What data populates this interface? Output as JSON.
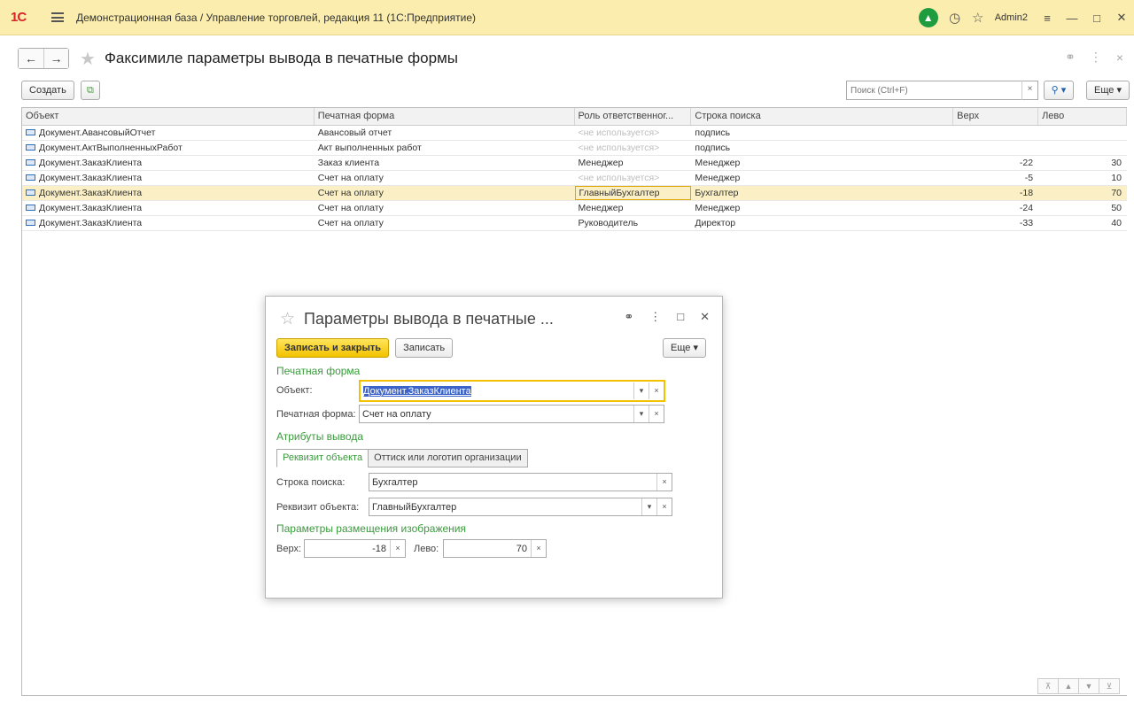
{
  "app": {
    "logo": "1С",
    "title": "Демонстрационная база / Управление торговлей, редакция 11  (1С:Предприятие)",
    "user": "Admin2"
  },
  "page": {
    "title": "Факсимиле параметры вывода в печатные формы",
    "create_label": "Создать",
    "search_placeholder": "Поиск (Ctrl+F)",
    "more_label": "Еще"
  },
  "table": {
    "columns": [
      "Объект",
      "Печатная форма",
      "Роль ответственног...",
      "Строка поиска",
      "Верх",
      "Лево"
    ],
    "rows": [
      {
        "object": "Документ.АвансовыйОтчет",
        "form": "Авансовый отчет",
        "role": "<не используется>",
        "search": "подпись",
        "top": "",
        "left": ""
      },
      {
        "object": "Документ.АктВыполненныхРабот",
        "form": "Акт выполненных работ",
        "role": "<не используется>",
        "search": "подпись",
        "top": "",
        "left": ""
      },
      {
        "object": "Документ.ЗаказКлиента",
        "form": "Заказ клиента",
        "role": "Менеджер",
        "search": "Менеджер",
        "top": "-22",
        "left": "30"
      },
      {
        "object": "Документ.ЗаказКлиента",
        "form": "Счет на оплату",
        "role": "<не используется>",
        "search": "Менеджер",
        "top": "-5",
        "left": "10"
      },
      {
        "object": "Документ.ЗаказКлиента",
        "form": "Счет на оплату",
        "role": "ГлавныйБухгалтер",
        "search": "Бухгалтер",
        "top": "-18",
        "left": "70"
      },
      {
        "object": "Документ.ЗаказКлиента",
        "form": "Счет на оплату",
        "role": "Менеджер",
        "search": "Менеджер",
        "top": "-24",
        "left": "50"
      },
      {
        "object": "Документ.ЗаказКлиента",
        "form": "Счет на оплату",
        "role": "Руководитель",
        "search": "Директор",
        "top": "-33",
        "left": "40"
      }
    ]
  },
  "dialog": {
    "title": "Параметры вывода в печатные ...",
    "save_close_label": "Записать и закрыть",
    "save_label": "Записать",
    "more_label": "Еще",
    "section_print_form": "Печатная форма",
    "object_label": "Объект:",
    "object_value": "Документ.ЗаказКлиента",
    "print_form_label": "Печатная форма:",
    "print_form_value": "Счет на оплату",
    "section_output_attrs": "Атрибуты вывода",
    "tab_object_attr": "Реквизит объекта",
    "tab_stamp": "Оттиск или логотип организации",
    "search_string_label": "Строка поиска:",
    "search_string_value": "Бухгалтер",
    "object_attr_label": "Реквизит объекта:",
    "object_attr_value": "ГлавныйБухгалтер",
    "section_placement": "Параметры размещения изображения",
    "top_label": "Верх:",
    "top_value": "-18",
    "left_label": "Лево:",
    "left_value": "70"
  }
}
